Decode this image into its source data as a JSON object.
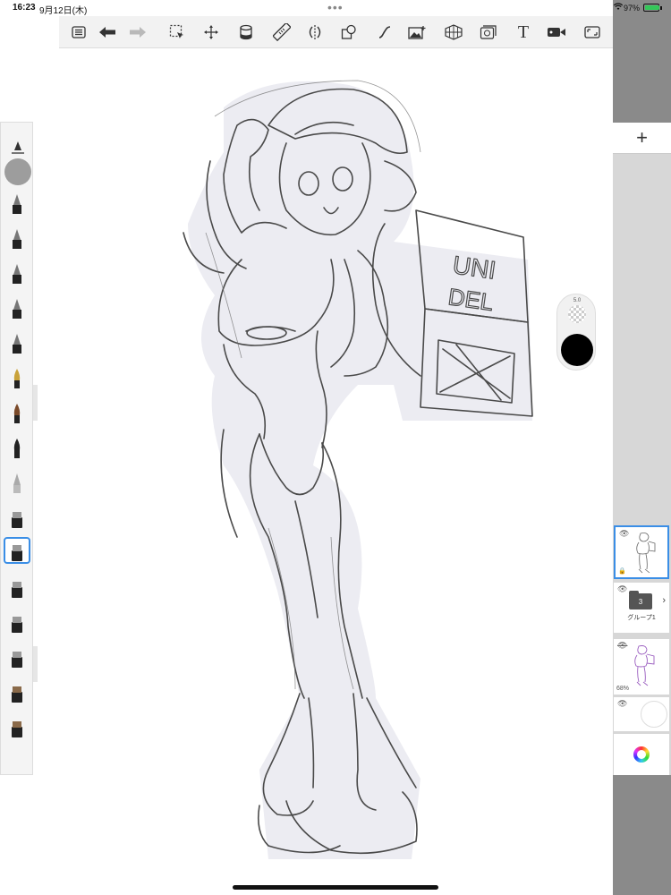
{
  "status_bar": {
    "time": "16:23",
    "date": "9月12日(木)",
    "battery": "97%",
    "battery_level": 0.97
  },
  "toolbar": {
    "tools": [
      {
        "name": "menu-icon"
      },
      {
        "name": "undo-icon"
      },
      {
        "name": "redo-icon",
        "disabled": true
      },
      {
        "name": "selection-icon"
      },
      {
        "name": "transform-icon"
      },
      {
        "name": "fill-icon"
      },
      {
        "name": "ruler-icon"
      },
      {
        "name": "symmetry-icon"
      },
      {
        "name": "shapes-icon"
      },
      {
        "name": "curve-icon"
      },
      {
        "name": "image-icon"
      },
      {
        "name": "perspective-icon"
      },
      {
        "name": "flipbook-icon"
      },
      {
        "name": "text-icon",
        "glyph": "T"
      },
      {
        "name": "record-icon"
      },
      {
        "name": "fullscreen-icon"
      }
    ]
  },
  "layers": {
    "add_label": "+",
    "items": [
      {
        "kind": "sketch",
        "selected": true,
        "visible": true
      },
      {
        "kind": "group",
        "name": "グループ1",
        "count": "3",
        "visible": true
      },
      {
        "kind": "reference",
        "opacity": "68%",
        "visible": false
      },
      {
        "kind": "paper",
        "visible": true
      }
    ]
  },
  "brushes": {
    "selected_index": 11,
    "count": 18
  },
  "brush_control": {
    "size": "5.0",
    "color": "#000000"
  }
}
